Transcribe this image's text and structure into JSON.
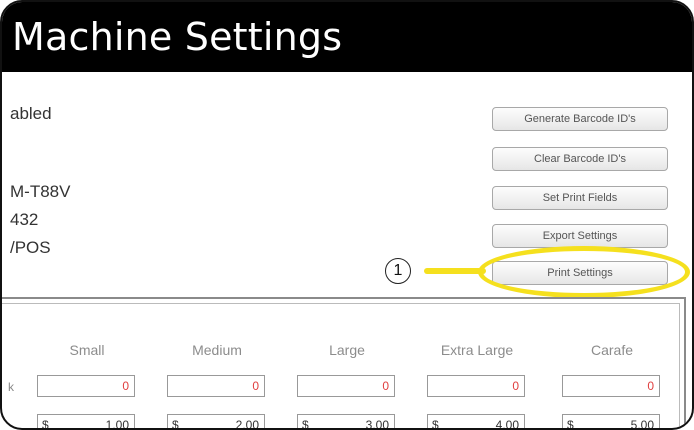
{
  "window": {
    "title": "Machine Settings"
  },
  "info_lines": [
    "abled",
    "M-T88V",
    "432",
    "/POS"
  ],
  "buttons": [
    "Generate Barcode ID's",
    "Clear Barcode ID's",
    "Set Print Fields",
    "Export Settings",
    "Print Settings"
  ],
  "callout": {
    "number": "1",
    "highlight_color": "#f5e01e"
  },
  "sizes": {
    "row_mark": "k",
    "columns": [
      {
        "name": "Small",
        "quantity": "0",
        "currency": "$",
        "price": "1.00"
      },
      {
        "name": "Medium",
        "quantity": "0",
        "currency": "$",
        "price": "2.00"
      },
      {
        "name": "Large",
        "quantity": "0",
        "currency": "$",
        "price": "3.00"
      },
      {
        "name": "Extra Large",
        "quantity": "0",
        "currency": "$",
        "price": "4.00"
      },
      {
        "name": "Carafe",
        "quantity": "0",
        "currency": "$",
        "price": "5.00"
      }
    ]
  }
}
